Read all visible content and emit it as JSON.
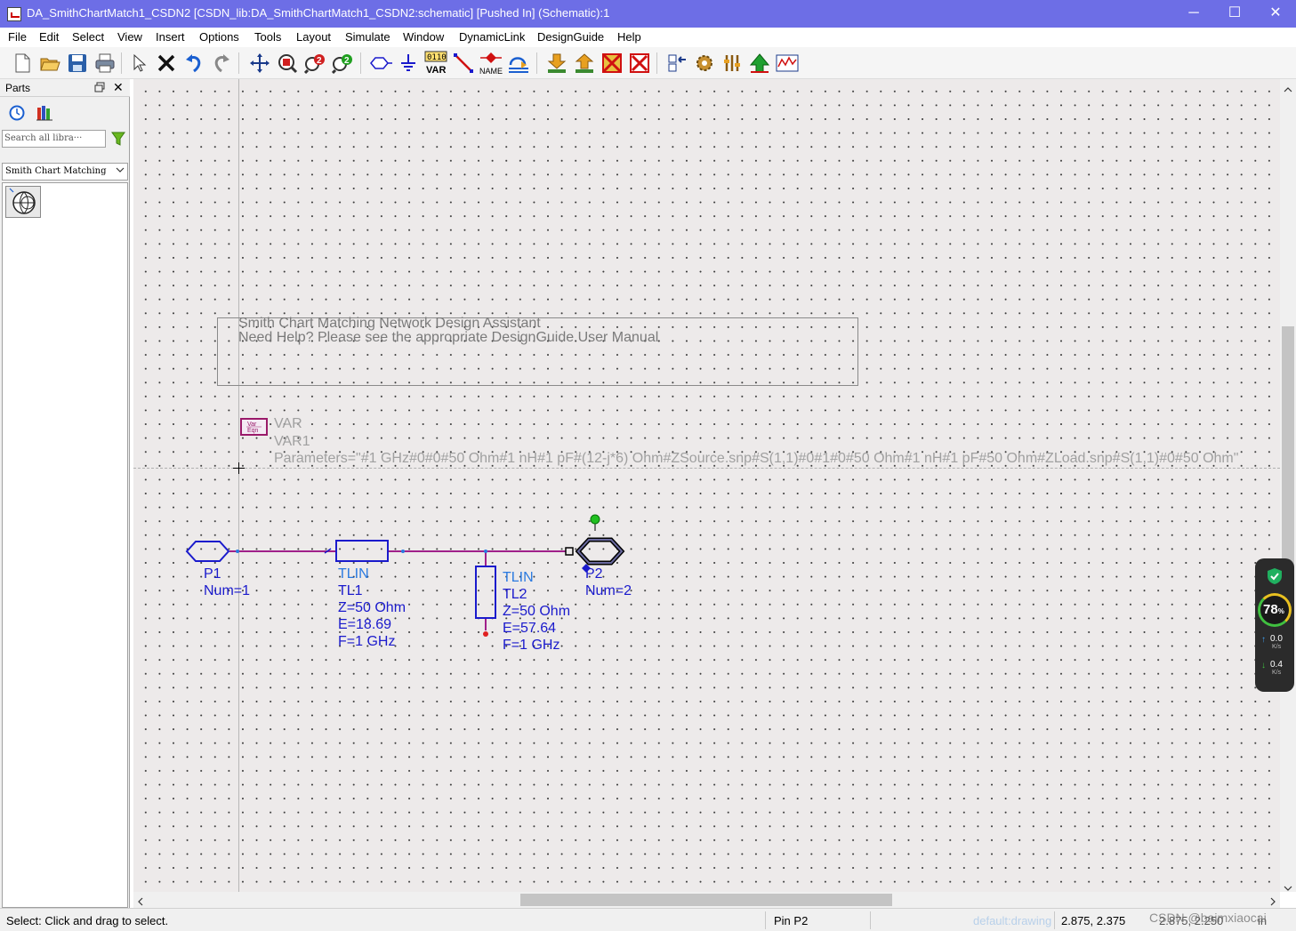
{
  "window": {
    "title": "DA_SmithChartMatch1_CSDN2 [CSDN_lib:DA_SmithChartMatch1_CSDN2:schematic] [Pushed In] (Schematic):1",
    "minimize": "─",
    "maximize": "☐",
    "close": "✕"
  },
  "menu": [
    "File",
    "Edit",
    "Select",
    "View",
    "Insert",
    "Options",
    "Tools",
    "Layout",
    "Simulate",
    "Window",
    "DynamicLink",
    "DesignGuide",
    "Help"
  ],
  "toolbar": {
    "var_top": "0110",
    "var_bottom": "VAR",
    "name_label": "NAME"
  },
  "parts": {
    "title": "Parts",
    "search_placeholder": "Search all libra···",
    "library": "Smith Chart Matching"
  },
  "schematic": {
    "banner_line1": "Smith Chart Matching Network Design Assistant",
    "banner_line2": "Need Help?  Please see the appropriate DesignGuide User Manual",
    "var": {
      "icon_line1": "Var",
      "icon_line2": "Eqn",
      "label": "VAR",
      "name": "VAR1",
      "params": "Parameters=\"#1 GHz#0#0#50 Ohm#1 nH#1 pF#(12-j*6) Ohm#ZSource.snp#S(1,1)#0#1#0#50 Ohm#1 nH#1 pF#50 Ohm#ZLoad.snp#S(1,1)#0#50 Ohm\""
    },
    "p1": {
      "name": "P1",
      "num": "Num=1"
    },
    "tl1": {
      "type": "TLIN",
      "name": "TL1",
      "z": "Z=50 Ohm",
      "e": "E=18.69",
      "f": "F=1 GHz"
    },
    "tl2": {
      "type": "TLIN",
      "name": "TL2",
      "z": "Z=50 Ohm",
      "e": "E=57.64",
      "f": "F=1 GHz"
    },
    "p2": {
      "name": "P2",
      "num": "Num=2"
    }
  },
  "meter": {
    "percent": "78",
    "percent_unit": "%",
    "up_value": "0.0",
    "up_unit": "K/s",
    "down_value": "0.4",
    "down_unit": "K/s"
  },
  "status": {
    "hint": "Select: Click and drag to select.",
    "pin": "Pin P2",
    "layer": "default:drawing",
    "coords1": "2.875, 2.375",
    "coords2": "2.875, 2.250",
    "unit": "in",
    "watermark": "CSDN @baimxiaocai"
  },
  "colors": {
    "titlebar": "#6d6ee6",
    "canvas": "#edeaea",
    "wire": "#a0208a",
    "component": "#1a1acc"
  }
}
